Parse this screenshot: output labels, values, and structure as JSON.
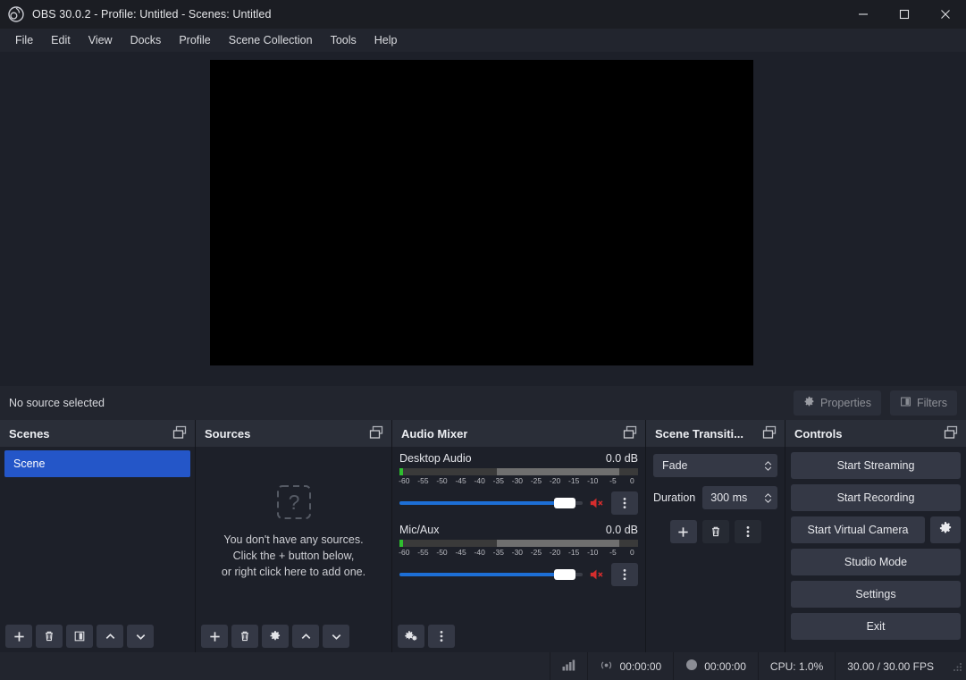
{
  "window": {
    "title": "OBS 30.0.2 - Profile: Untitled - Scenes: Untitled",
    "app_icon": "obs-logo-icon",
    "minimize_label": "—",
    "maximize_label": "☐",
    "close_label": "✕"
  },
  "menubar": {
    "items": [
      {
        "label": "File"
      },
      {
        "label": "Edit"
      },
      {
        "label": "View"
      },
      {
        "label": "Docks"
      },
      {
        "label": "Profile"
      },
      {
        "label": "Scene Collection"
      },
      {
        "label": "Tools"
      },
      {
        "label": "Help"
      }
    ]
  },
  "preview": {
    "canvas_color": "#000000",
    "background_color": "#1d2029"
  },
  "source_toolbar": {
    "status_text": "No source selected",
    "properties_label": "Properties",
    "filters_label": "Filters"
  },
  "scenes": {
    "title": "Scenes",
    "items": [
      {
        "label": "Scene",
        "selected": true
      }
    ],
    "selected_color": "#2456c8",
    "tools": [
      {
        "name": "add-scene-button",
        "icon": "plus-icon"
      },
      {
        "name": "remove-scene-button",
        "icon": "trash-icon"
      },
      {
        "name": "scene-filters-button",
        "icon": "filters-icon"
      },
      {
        "name": "move-scene-up-button",
        "icon": "chevron-up-icon"
      },
      {
        "name": "move-scene-down-button",
        "icon": "chevron-down-icon"
      }
    ]
  },
  "sources": {
    "title": "Sources",
    "empty_icon": "question-mark-icon",
    "empty_lines": [
      "You don't have any sources.",
      "Click the + button below,",
      "or right click here to add one."
    ],
    "tools": [
      {
        "name": "add-source-button",
        "icon": "plus-icon"
      },
      {
        "name": "remove-source-button",
        "icon": "trash-icon"
      },
      {
        "name": "source-properties-button",
        "icon": "gear-icon"
      },
      {
        "name": "move-source-up-button",
        "icon": "chevron-up-icon"
      },
      {
        "name": "move-source-down-button",
        "icon": "chevron-down-icon"
      }
    ]
  },
  "audio_mixer": {
    "title": "Audio Mixer",
    "scale_ticks": [
      "-60",
      "-55",
      "-50",
      "-45",
      "-40",
      "-35",
      "-30",
      "-25",
      "-20",
      "-15",
      "-10",
      "-5",
      "0"
    ],
    "tracks": [
      {
        "name": "Desktop Audio",
        "db": "0.0 dB",
        "volume_percent": 90,
        "muted": false
      },
      {
        "name": "Mic/Aux",
        "db": "0.0 dB",
        "volume_percent": 90,
        "muted": false
      }
    ],
    "tools": [
      {
        "name": "advanced-audio-properties-button",
        "icon": "gears-icon"
      },
      {
        "name": "audio-mixer-menu-button",
        "icon": "kebab-menu-icon"
      }
    ]
  },
  "scene_transitions": {
    "title": "Scene Transiti...",
    "transition": "Fade",
    "duration_label": "Duration",
    "duration_value": "300 ms",
    "tools": [
      {
        "name": "add-transition-button",
        "icon": "plus-icon"
      },
      {
        "name": "remove-transition-button",
        "icon": "trash-icon"
      },
      {
        "name": "transition-properties-button",
        "icon": "kebab-menu-icon"
      }
    ]
  },
  "controls": {
    "title": "Controls",
    "start_streaming": "Start Streaming",
    "start_recording": "Start Recording",
    "start_virtual_camera": "Start Virtual Camera",
    "virtual_camera_settings_icon": "gear-icon",
    "studio_mode": "Studio Mode",
    "settings": "Settings",
    "exit": "Exit"
  },
  "statusbar": {
    "signal_icon": "signal-bars-icon",
    "stream_icon": "broadcast-icon",
    "stream_time": "00:00:00",
    "record_icon": "record-dot-icon",
    "record_time": "00:00:00",
    "cpu": "CPU: 1.0%",
    "fps": "30.00 / 30.00 FPS"
  }
}
